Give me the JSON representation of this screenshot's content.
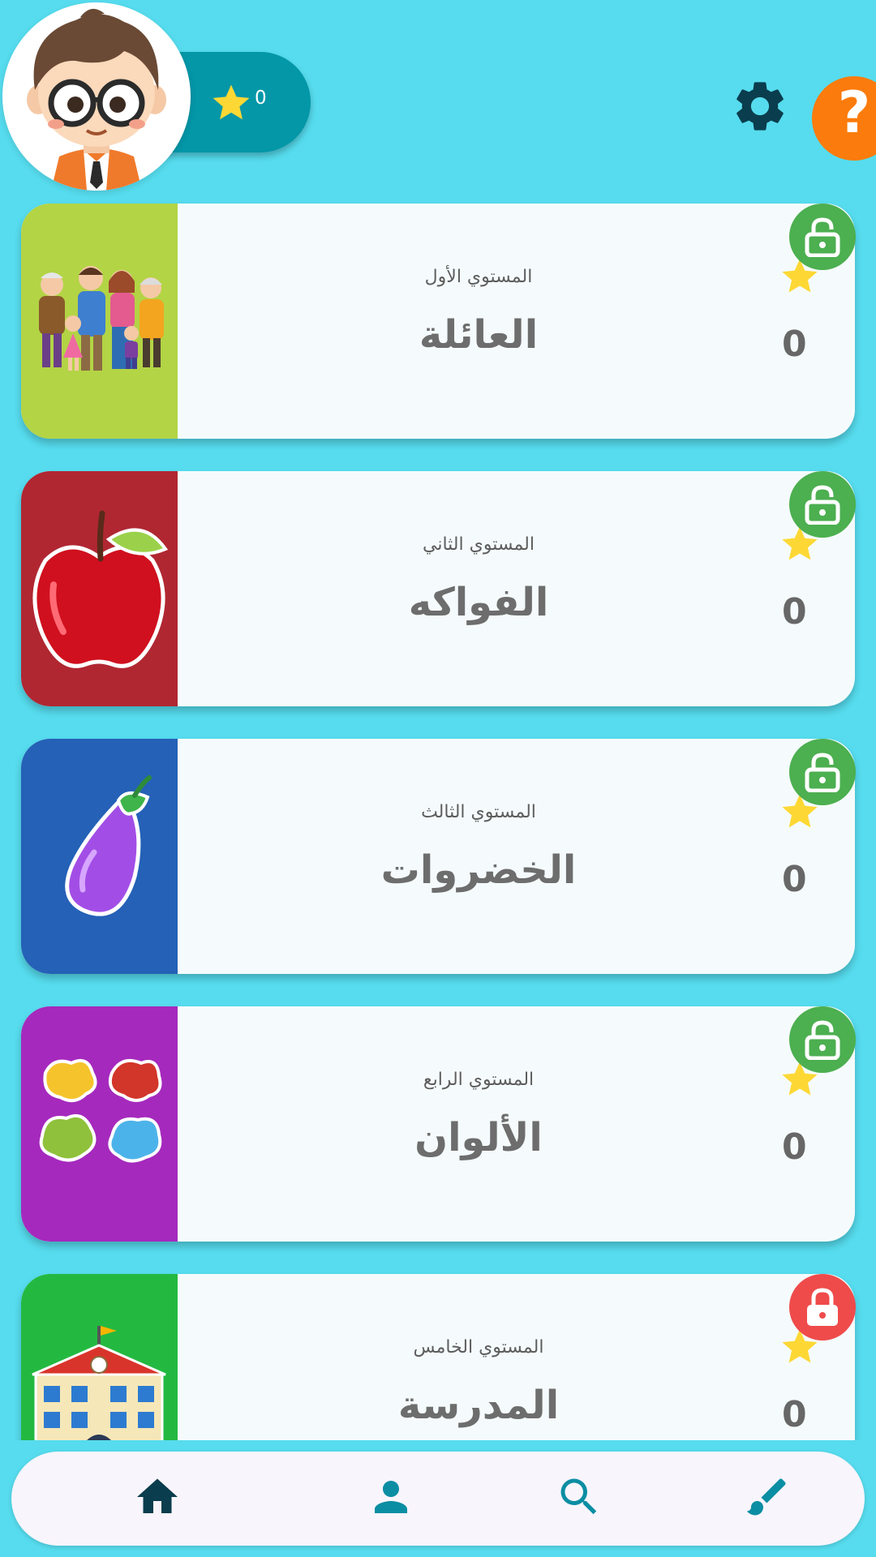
{
  "header": {
    "avatar_icon": "boy-avatar-with-glasses",
    "stars_total": "0",
    "settings_icon": "gear-icon",
    "help_label": "?"
  },
  "levels": [
    {
      "subtitle": "المستوي الأول",
      "title": "العائلة",
      "score": "0",
      "thumb_color": "#b3d445",
      "thumb_icon": "family-icon",
      "status": "unlocked"
    },
    {
      "subtitle": "المستوي الثاني",
      "title": "الفواكه",
      "score": "0",
      "thumb_color": "#b02732",
      "thumb_icon": "apple-icon",
      "status": "unlocked"
    },
    {
      "subtitle": "المستوي الثالث",
      "title": "الخضروات",
      "score": "0",
      "thumb_color": "#2461b7",
      "thumb_icon": "eggplant-icon",
      "status": "unlocked"
    },
    {
      "subtitle": "المستوي الرابع",
      "title": "الألوان",
      "score": "0",
      "thumb_color": "#a529bd",
      "thumb_icon": "paint-splash-icon",
      "status": "unlocked"
    },
    {
      "subtitle": "المستوي الخامس",
      "title": "المدرسة",
      "score": "0",
      "thumb_color": "#23b941",
      "thumb_icon": "school-icon",
      "status": "locked"
    }
  ],
  "colors": {
    "background": "#56dcee",
    "unlocked_badge": "#4caf50",
    "locked_badge": "#ef4b4b",
    "star": "#fdd835",
    "nav_icon": "#0b8ea3",
    "nav_home": "#0a3d4d"
  },
  "bottom_nav": [
    {
      "icon": "home-icon"
    },
    {
      "icon": "person-icon"
    },
    {
      "icon": "search-icon"
    },
    {
      "icon": "brush-icon"
    }
  ]
}
